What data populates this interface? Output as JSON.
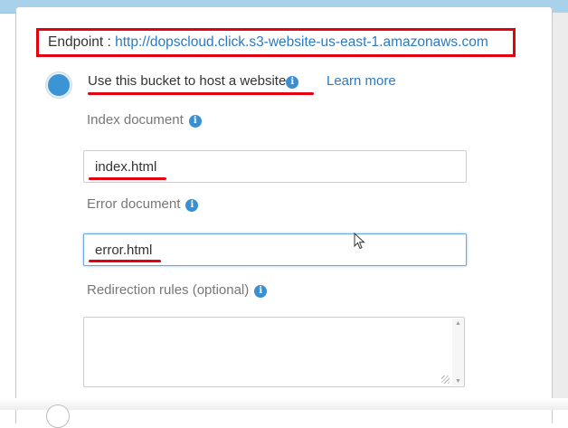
{
  "endpoint": {
    "label": "Endpoint :",
    "url": "http://dopscloud.click.s3-website-us-east-1.amazonaws.com"
  },
  "hosting_option": {
    "label": "Use this bucket to host a website",
    "selected": true,
    "learn_more": "Learn more"
  },
  "index_document": {
    "label": "Index document",
    "value": "index.html"
  },
  "error_document": {
    "label": "Error document",
    "value": "error.html"
  },
  "redirection_rules": {
    "label": "Redirection rules (optional)",
    "value": ""
  },
  "icons": {
    "info": "info-icon",
    "cursor": "mouse-pointer-icon"
  },
  "colors": {
    "link": "#2a7ac5",
    "radio_selected": "#3a94d6",
    "annotation": "#e3000f",
    "top_bar": "#a8d1ec"
  }
}
